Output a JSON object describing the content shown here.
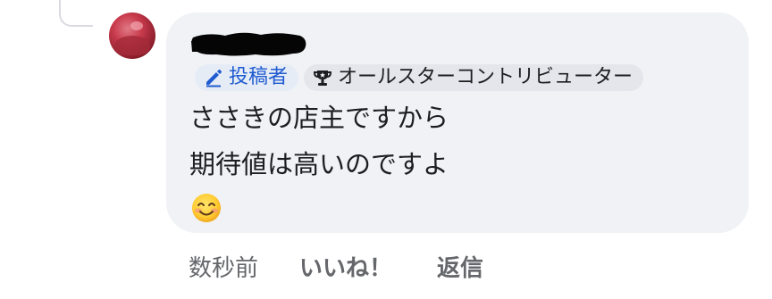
{
  "comment": {
    "author_name": "",
    "badges": {
      "author_label": "投稿者",
      "author_icon": "pencil-icon",
      "star_label": "オールスターコントリビューター",
      "star_icon": "trophy-icon"
    },
    "text_lines": [
      "ささきの店主ですから",
      "期待値は高いのですよ"
    ],
    "emoji": "smiling-face-icon"
  },
  "actions": {
    "timestamp": "数秒前",
    "like_label": "いいね！",
    "reply_label": "返信"
  },
  "colors": {
    "bubble_bg": "#f0f2f5",
    "author_badge_text": "#1f5bd0",
    "meta_text": "#65676b"
  }
}
